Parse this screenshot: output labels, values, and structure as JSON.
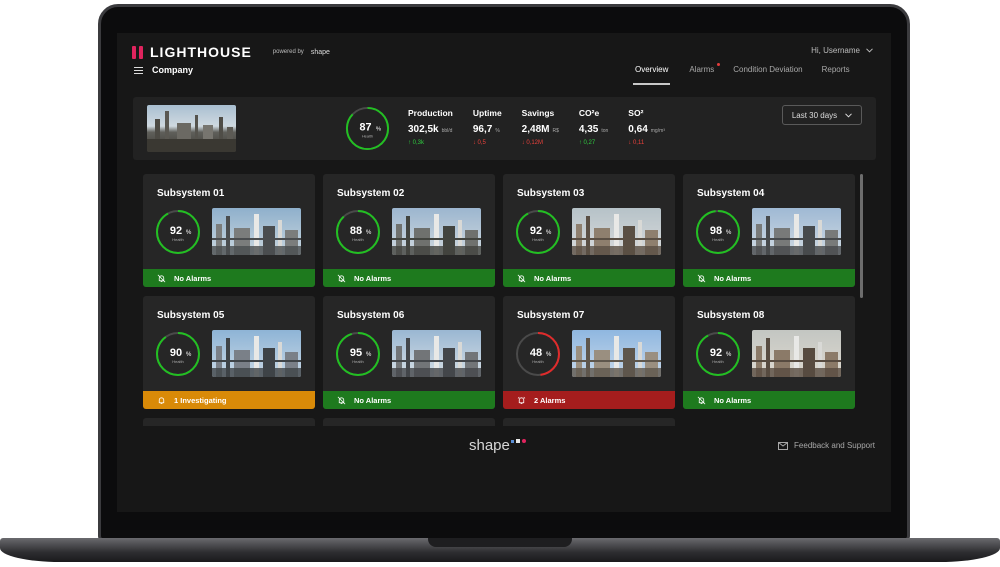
{
  "app": {
    "logo_text": "LIGHTHOUSE",
    "powered_label": "powered by",
    "powered_brand": "shape",
    "user_greeting": "Hi, Username",
    "company": "Company"
  },
  "nav": {
    "tabs": [
      {
        "label": "Overview",
        "active": true
      },
      {
        "label": "Alarms",
        "active": false
      },
      {
        "label": "Condition Deviation",
        "active": false
      },
      {
        "label": "Reports",
        "active": false
      }
    ]
  },
  "summary": {
    "health_value": 87,
    "health_unit": "%",
    "health_label": "Health",
    "date_range": "Last 30 days",
    "kpis": [
      {
        "label": "Production",
        "value": "302,5k",
        "unit": "bbl/d",
        "delta": "0,3k",
        "direction": "up"
      },
      {
        "label": "Uptime",
        "value": "96,7",
        "unit": "%",
        "delta": "0,5",
        "direction": "down"
      },
      {
        "label": "Savings",
        "value": "2,48M",
        "unit": "R$",
        "delta": "0,12M",
        "direction": "down"
      },
      {
        "label": "CO²e",
        "value": "4,35",
        "unit": "ton",
        "delta": "0,27",
        "direction": "up"
      },
      {
        "label": "SO²",
        "value": "0,64",
        "unit": "mg/m³",
        "delta": "0,11",
        "direction": "down"
      }
    ]
  },
  "subsystems": [
    {
      "title": "Subsystem 01",
      "health": 92,
      "status": "No Alarms",
      "status_type": "ok"
    },
    {
      "title": "Subsystem 02",
      "health": 88,
      "status": "No Alarms",
      "status_type": "ok"
    },
    {
      "title": "Subsystem 03",
      "health": 92,
      "status": "No Alarms",
      "status_type": "ok"
    },
    {
      "title": "Subsystem 04",
      "health": 98,
      "status": "No Alarms",
      "status_type": "ok"
    },
    {
      "title": "Subsystem 05",
      "health": 90,
      "status": "1 Investigating",
      "status_type": "warning"
    },
    {
      "title": "Subsystem 06",
      "health": 95,
      "status": "No Alarms",
      "status_type": "ok"
    },
    {
      "title": "Subsystem 07",
      "health": 48,
      "status": "2 Alarms",
      "status_type": "alarm"
    },
    {
      "title": "Subsystem 08",
      "health": 92,
      "status": "No Alarms",
      "status_type": "ok"
    }
  ],
  "health_label": "Health",
  "health_unit": "%",
  "footer": {
    "brand": "shape",
    "feedback": "Feedback and Support"
  },
  "colors": {
    "ok": "#1e7a1e",
    "warning": "#d98a08",
    "alarm": "#a51d1d",
    "gauge_ok": "#22c022",
    "gauge_bad": "#e02b2b",
    "gauge_track": "#4a4a4a",
    "brand_dot_1": "#5b8fd6",
    "brand_dot_2": "#e8e8e8",
    "brand_dot_3": "#e0245e"
  },
  "icons": {
    "status_ok": "bell-off-icon",
    "status_warning": "bell-icon",
    "status_alarm": "alarm-bell-icon",
    "feedback": "message-icon",
    "date_dropdown": "chevron-down-icon",
    "menu": "hamburger-menu-icon"
  }
}
